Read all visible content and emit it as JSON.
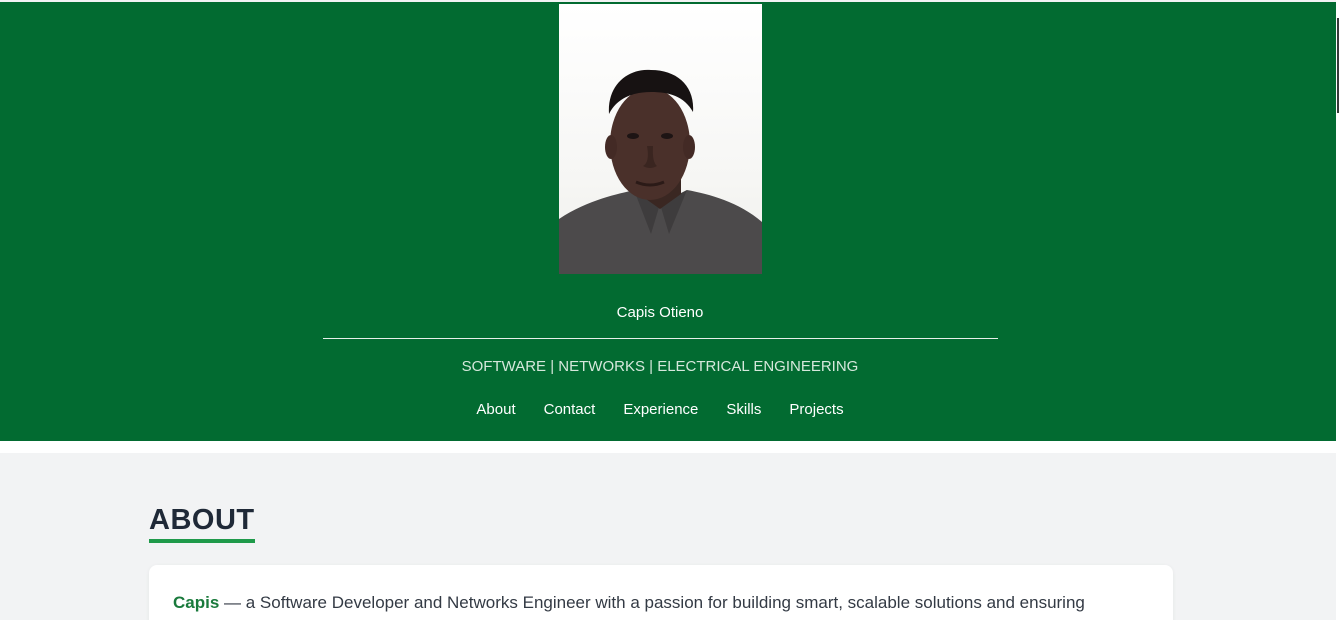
{
  "profile": {
    "name": "Capis Otieno",
    "tagline": "SOFTWARE | NETWORKS | ELECTRICAL ENGINEERING"
  },
  "nav": {
    "items": [
      {
        "label": "About"
      },
      {
        "label": "Contact"
      },
      {
        "label": "Experience"
      },
      {
        "label": "Skills"
      },
      {
        "label": "Projects"
      }
    ]
  },
  "about": {
    "title": "ABOUT",
    "highlight": "Capis",
    "text": " — a Software Developer and Networks Engineer with a passion for building smart, scalable solutions and ensuring"
  },
  "colors": {
    "header_bg": "#026b31",
    "accent": "#1f9a4a",
    "highlight": "#1a7a3c",
    "page_bg": "#f2f3f4"
  }
}
